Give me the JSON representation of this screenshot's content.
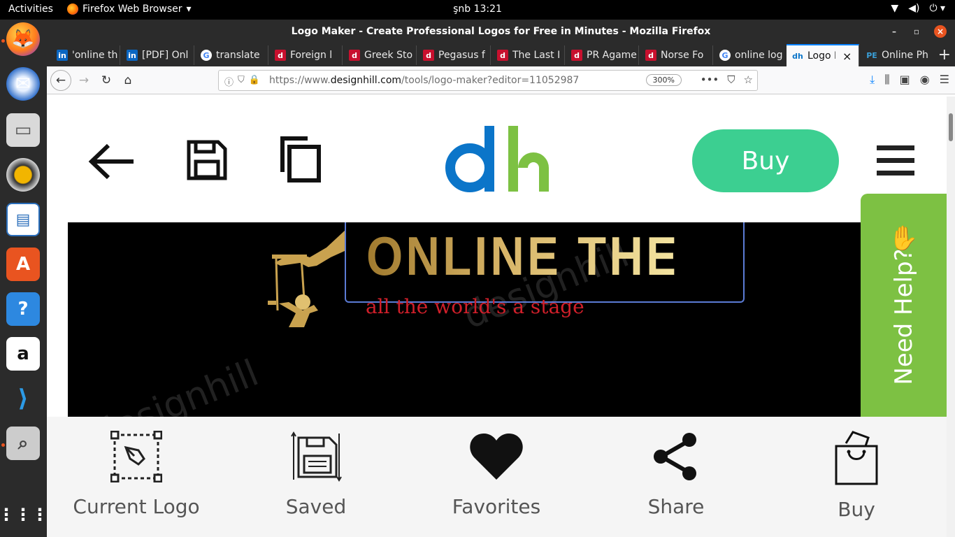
{
  "gnome": {
    "activities": "Activities",
    "app_menu": "Firefox Web Browser",
    "clock": "şnb 13:21"
  },
  "window": {
    "title": "Logo Maker - Create Professional Logos for Free in Minutes - Mozilla Firefox"
  },
  "tabs": [
    {
      "label": "'online th",
      "favicon": "in"
    },
    {
      "label": "[PDF] Onl",
      "favicon": "in"
    },
    {
      "label": "translate",
      "favicon": "G"
    },
    {
      "label": "Foreign l",
      "favicon": "d"
    },
    {
      "label": "Greek Sto",
      "favicon": "d"
    },
    {
      "label": "Pegasus f",
      "favicon": "d"
    },
    {
      "label": "The Last I",
      "favicon": "d"
    },
    {
      "label": "PR Agame",
      "favicon": "d"
    },
    {
      "label": "Norse Fo",
      "favicon": "d"
    },
    {
      "label": "online log",
      "favicon": "G"
    },
    {
      "label": "Logo M",
      "favicon": "dh"
    },
    {
      "label": "Online Ph",
      "favicon": "PE"
    }
  ],
  "url": {
    "prefix": "https://www.",
    "domain": "designhill.com",
    "path": "/tools/logo-maker?editor=11052987",
    "zoom": "300%"
  },
  "site_header": {
    "logo": "dh",
    "buy": "Buy"
  },
  "canvas": {
    "brand_name": "ONLINE THEATRE",
    "tagline": "all the world's a stage",
    "watermark": "designhill"
  },
  "help": {
    "label": "Need Help?"
  },
  "bottom_nav": [
    {
      "label": "Current Logo"
    },
    {
      "label": "Saved"
    },
    {
      "label": "Favorites"
    },
    {
      "label": "Share"
    },
    {
      "label": "Buy"
    }
  ],
  "colors": {
    "buy_green": "#3ccf91",
    "help_green": "#7dc143",
    "dh_blue": "#0b75c9",
    "dh_green": "#7dc143",
    "gold": "#c9a24f",
    "tagline_red": "#d01f2a"
  }
}
